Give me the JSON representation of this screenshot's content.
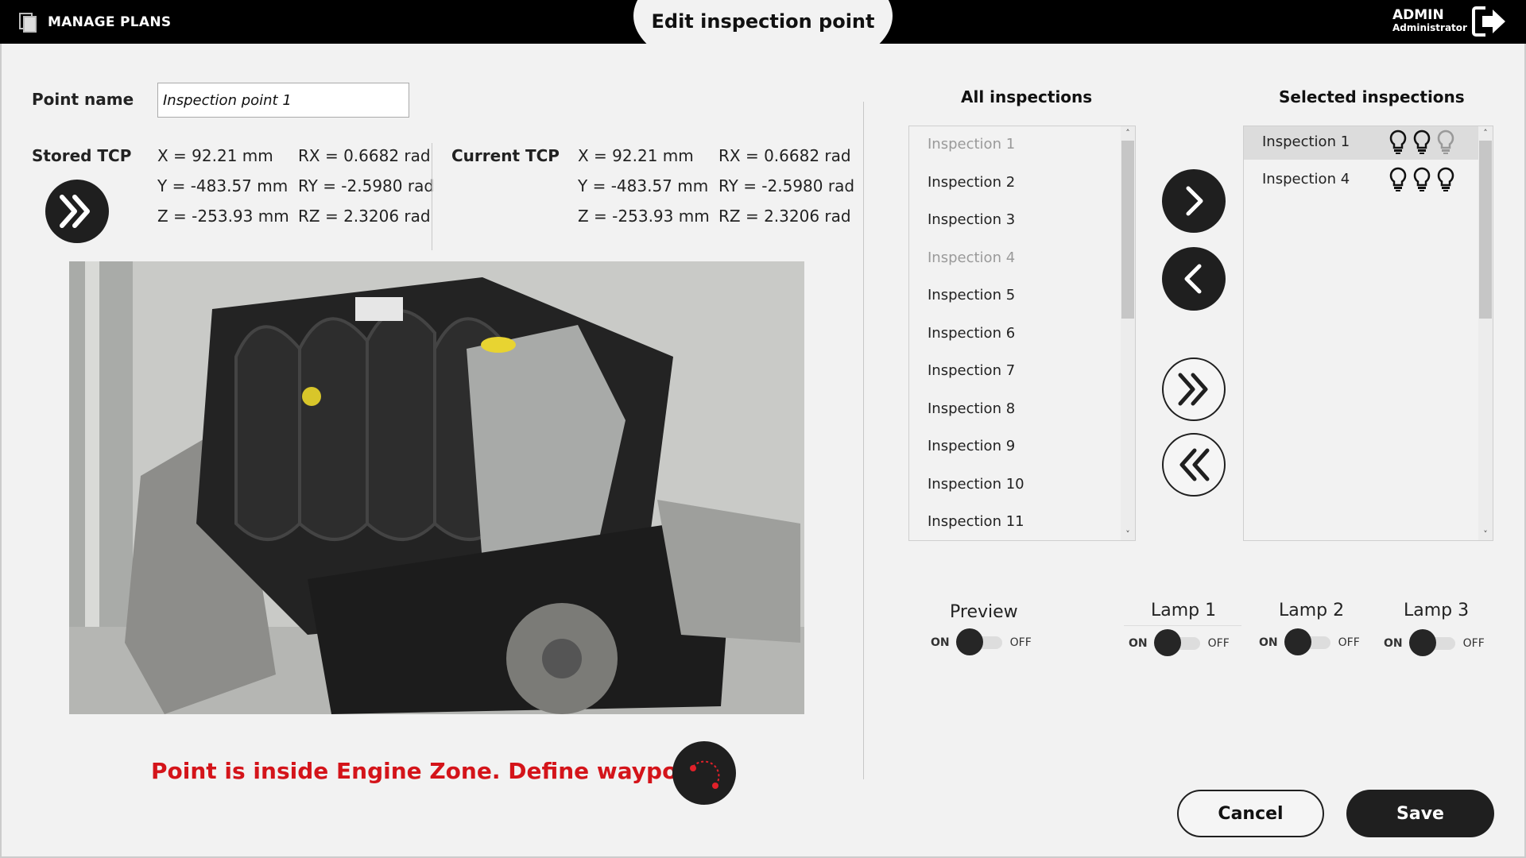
{
  "header": {
    "manage_plans_label": "MANAGE PLANS",
    "title": "Edit inspection point",
    "user_name": "ADMIN",
    "user_role": "Administrator"
  },
  "point": {
    "name_label": "Point name",
    "name_value": "Inspection point 1"
  },
  "stored_tcp": {
    "label": "Stored TCP",
    "x": "X = 92.21 mm",
    "y": "Y = -483.57 mm",
    "z": "Z = -253.93 mm",
    "rx": "RX = 0.6682 rad",
    "ry": "RY = -2.5980 rad",
    "rz": "RZ = 2.3206 rad"
  },
  "current_tcp": {
    "label": "Current TCP",
    "x": "X = 92.21 mm",
    "y": "Y = -483.57 mm",
    "z": "Z = -253.93 mm",
    "rx": "RX = 0.6682 rad",
    "ry": "RY = -2.5980 rad",
    "rz": "RZ = 2.3206 rad"
  },
  "warning": "Point is inside Engine Zone. Define waypoints",
  "all_inspections": {
    "header": "All inspections",
    "items": [
      {
        "label": "Inspection 1",
        "dim": true
      },
      {
        "label": "Inspection 2",
        "dim": false
      },
      {
        "label": "Inspection 3",
        "dim": false
      },
      {
        "label": "Inspection 4",
        "dim": true
      },
      {
        "label": "Inspection 5",
        "dim": false
      },
      {
        "label": "Inspection 6",
        "dim": false
      },
      {
        "label": "Inspection 7",
        "dim": false
      },
      {
        "label": "Inspection 8",
        "dim": false
      },
      {
        "label": "Inspection 9",
        "dim": false
      },
      {
        "label": "Inspection 10",
        "dim": false
      },
      {
        "label": "Inspection 11",
        "dim": false
      }
    ]
  },
  "selected_inspections": {
    "header": "Selected inspections",
    "items": [
      {
        "label": "Inspection 1",
        "lamps": [
          "on",
          "on",
          "off"
        ]
      },
      {
        "label": "Inspection 4",
        "lamps": [
          "on",
          "on",
          "on"
        ]
      }
    ]
  },
  "toggles": {
    "on_label": "ON",
    "off_label": "OFF",
    "preview": "Preview",
    "lamp1": "Lamp 1",
    "lamp2": "Lamp 2",
    "lamp3": "Lamp 3"
  },
  "actions": {
    "cancel": "Cancel",
    "save": "Save"
  },
  "colors": {
    "warning": "#d4141a",
    "dark": "#1f1f1f",
    "background": "#f2f2f2"
  }
}
